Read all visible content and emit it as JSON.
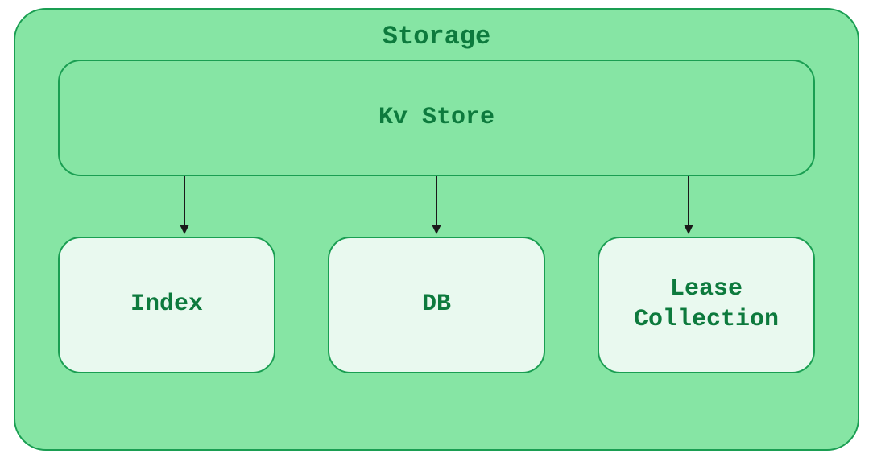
{
  "container": {
    "title": "Storage"
  },
  "parent_box": {
    "label": "Kv Store"
  },
  "children": [
    {
      "label": "Index"
    },
    {
      "label": "DB"
    },
    {
      "label": "Lease Collection"
    }
  ]
}
